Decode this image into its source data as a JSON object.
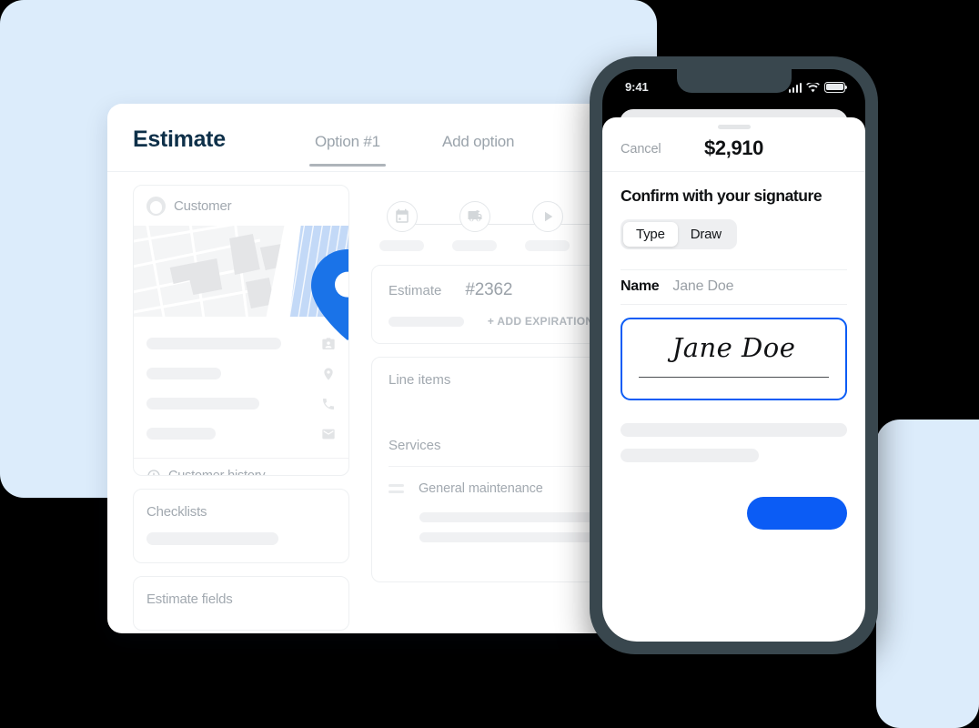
{
  "theme": {
    "page_background": "#000000",
    "decor_blue": "#dcecfb",
    "accent_blue": "#0b5cf5",
    "title_navy": "#0e3049",
    "muted_gray": "#a2a9b0",
    "phone_frame": "#39474e"
  },
  "desktop": {
    "title": "Estimate",
    "tabs": [
      {
        "label": "Option #1",
        "active": true
      },
      {
        "label": "Add option",
        "active": false
      }
    ],
    "customer_card": {
      "title": "Customer",
      "avatar_icon": "avatar-icon",
      "map": {
        "pin_icon": "map-pin-icon",
        "pin_color": "#1a73e8",
        "water_color": "#c3d9f7"
      },
      "contact_rows": [
        {
          "icon": "contact-badge-icon"
        },
        {
          "icon": "location-pin-icon"
        },
        {
          "icon": "phone-icon"
        },
        {
          "icon": "mail-icon"
        }
      ],
      "history_label": "Customer history",
      "history_icon": "clock-history-icon"
    },
    "checklists_card": {
      "title": "Checklists"
    },
    "estimate_fields_card": {
      "title": "Estimate fields"
    },
    "stepper": {
      "steps": [
        {
          "icon": "calendar-icon"
        },
        {
          "icon": "truck-icon"
        },
        {
          "icon": "play-icon"
        }
      ]
    },
    "estimate_card": {
      "label": "Estimate",
      "number": "#2362",
      "add_expiration_label": "+ ADD EXPIRATION DATE"
    },
    "items_card": {
      "line_items_title": "Line items",
      "services_title": "Services",
      "service_row": {
        "drag_icon": "drag-handle-icon",
        "name": "General maintenance"
      }
    }
  },
  "phone": {
    "status_bar": {
      "time": "9:41",
      "signal_icon": "signal-bars-icon",
      "wifi_icon": "wifi-icon",
      "battery_icon": "battery-icon"
    },
    "sheet": {
      "cancel_label": "Cancel",
      "amount": "$2,910",
      "heading": "Confirm with your signature",
      "segmented": [
        {
          "label": "Type",
          "active": true
        },
        {
          "label": "Draw",
          "active": false
        }
      ],
      "name_label": "Name",
      "name_value": "Jane Doe",
      "signature_text": "Jane Doe",
      "submit_label": ""
    }
  }
}
